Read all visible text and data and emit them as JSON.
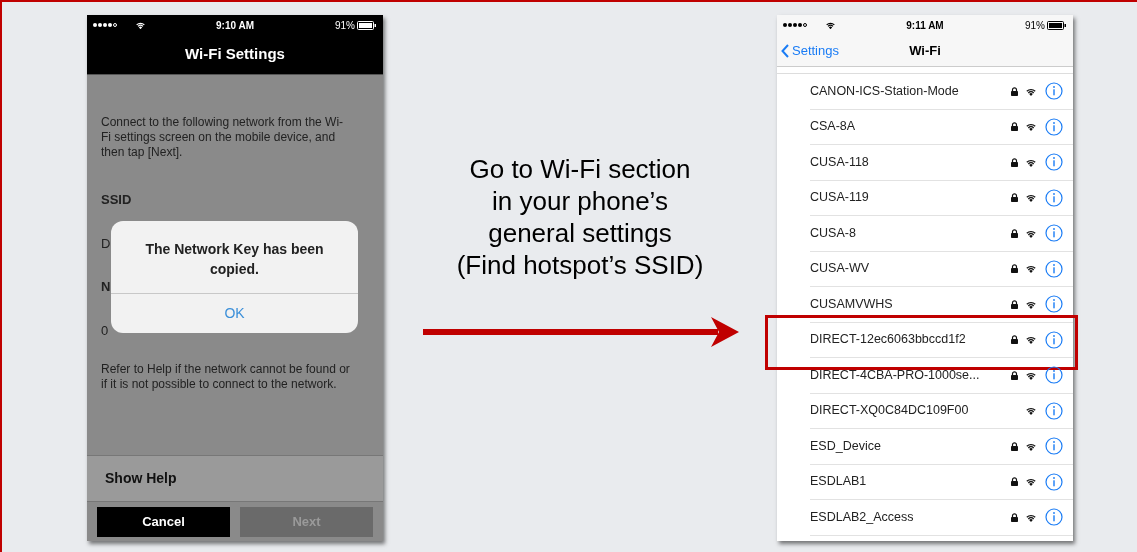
{
  "left_phone": {
    "status_bar": {
      "time": "9:10 AM",
      "battery": "91%"
    },
    "title": "Wi-Fi Settings",
    "instructions": "Connect to the following network from the Wi-Fi settings screen on the mobile device, and then tap [Next].",
    "ssid_label": "SSID",
    "hidden_fragments": [
      "D",
      "N",
      "0"
    ],
    "help_note": "Refer to Help if the network cannot be found or if it is not possible to connect to the network.",
    "alert": {
      "message": "The Network Key has been copied.",
      "button": "OK"
    },
    "show_help": "Show Help",
    "buttons": [
      {
        "label": "Cancel",
        "disabled": false
      },
      {
        "label": "Next",
        "disabled": true
      }
    ]
  },
  "caption_lines": [
    "Go to Wi-Fi section",
    "in your phone’s",
    "general settings",
    "(Find hotspot’s SSID)"
  ],
  "right_phone": {
    "status_bar": {
      "time": "9:11 AM",
      "battery": "91%"
    },
    "back": "Settings",
    "title": "Wi-Fi",
    "networks": [
      {
        "name": "CANON-ICS-Station-Mode",
        "locked": true,
        "highlighted": false
      },
      {
        "name": "CSA-8A",
        "locked": true,
        "highlighted": false
      },
      {
        "name": "CUSA-118",
        "locked": true,
        "highlighted": false
      },
      {
        "name": "CUSA-119",
        "locked": true,
        "highlighted": false
      },
      {
        "name": "CUSA-8",
        "locked": true,
        "highlighted": false
      },
      {
        "name": "CUSA-WV",
        "locked": true,
        "highlighted": false
      },
      {
        "name": "CUSAMVWHS",
        "locked": true,
        "highlighted": false
      },
      {
        "name": "DIRECT-12ec6063bbccd1f2",
        "locked": true,
        "highlighted": true
      },
      {
        "name": "DIRECT-4CBA-PRO-1000se...",
        "locked": true,
        "highlighted": false
      },
      {
        "name": "DIRECT-XQ0C84DC109F00",
        "locked": false,
        "highlighted": false
      },
      {
        "name": "ESD_Device",
        "locked": true,
        "highlighted": false
      },
      {
        "name": "ESDLAB1",
        "locked": true,
        "highlighted": false
      },
      {
        "name": "ESDLAB2_Access",
        "locked": true,
        "highlighted": false
      }
    ]
  }
}
